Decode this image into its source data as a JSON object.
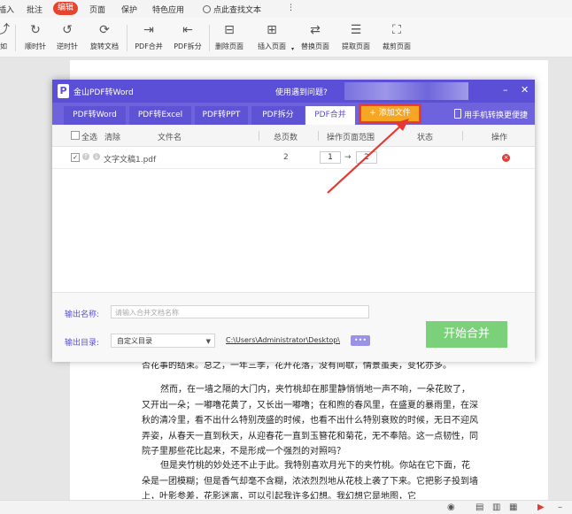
{
  "menu": {
    "items": [
      "插入",
      "批注",
      "编辑",
      "页面",
      "保护",
      "特色应用"
    ],
    "active": "编辑",
    "search_label": "点此查找文本",
    "more": "⋮"
  },
  "ribbon": {
    "first_label": "如",
    "buttons": [
      "顺时针",
      "逆时针",
      "旋转文档",
      "PDF合并",
      "PDF拆分",
      "删除页面",
      "插入页面",
      "替换页面",
      "提取页面",
      "裁剪页面"
    ]
  },
  "dialog": {
    "title": "金山PDF转Word",
    "help": "使用遇到问题?",
    "window_controls": {
      "minimize": "–",
      "close": "✕"
    },
    "tabs": [
      "PDF转Word",
      "PDF转Excel",
      "PDF转PPT",
      "PDF拆分",
      "PDF合并"
    ],
    "active_tab": "PDF合并",
    "add_file": "+ 添加文件",
    "phone_link": "用手机转换更便捷",
    "table": {
      "headers": {
        "select_all": "全选",
        "clear": "清除",
        "file_name": "文件名",
        "total_pages": "总页数",
        "page_range": "操作页面范围",
        "status": "状态",
        "action": "操作"
      },
      "rows": [
        {
          "checked": "✓",
          "name": "文字文稿1.pdf",
          "pages": "2",
          "range_from": "1",
          "range_arrow": "→",
          "range_to": "2",
          "status": ""
        }
      ]
    },
    "output_name_label": "输出名称:",
    "output_name_placeholder": "请输入合并文档名称",
    "output_dir_label": "输出目录:",
    "output_dir_value": "自定义目录",
    "output_dir_path": "C:\\Users\\Administrator\\Desktop\\",
    "more_button": "•••",
    "start_button": "开始合并"
  },
  "document": {
    "line0": "否花事的结束。总之，一年三季，花开花落，没有间歇，情景虽美，变化亦多。",
    "para1": "然而，在一墙之隔的大门内，夹竹桃却在那里静悄悄地一声不响，一朵花败了，又开出一朵；一嘟噜花黄了，又长出一嘟噜；在和煦的春风里，在盛夏的暴雨里，在深秋的清冷里，看不出什么特别茂盛的时候，也看不出什么特别衰败的时候，无日不迎风弄姿，从春天一直到秋天，从迎春花一直到玉簪花和菊花，无不奉陪。这一点韧性，同院子里那些花比起来，不是形成一个强烈的对照吗？",
    "para2": "但是夹竹桃的妙处还不止于此。我特别喜欢月光下的夹竹桃。你站在它下面，花朵是一团模糊；但是香气却毫不含糊，浓浓烈烈地从花枝上袭了下来。它把影子投到墙上，叶影参差，花影迷离，可以引起我许多幻想。我幻想它是地图，它"
  },
  "colors": {
    "accent": "#5a4fd6",
    "menu_active": "#e8432f",
    "add_file": "#f6a623",
    "start": "#7bd17a",
    "highlight": "#e53935"
  }
}
